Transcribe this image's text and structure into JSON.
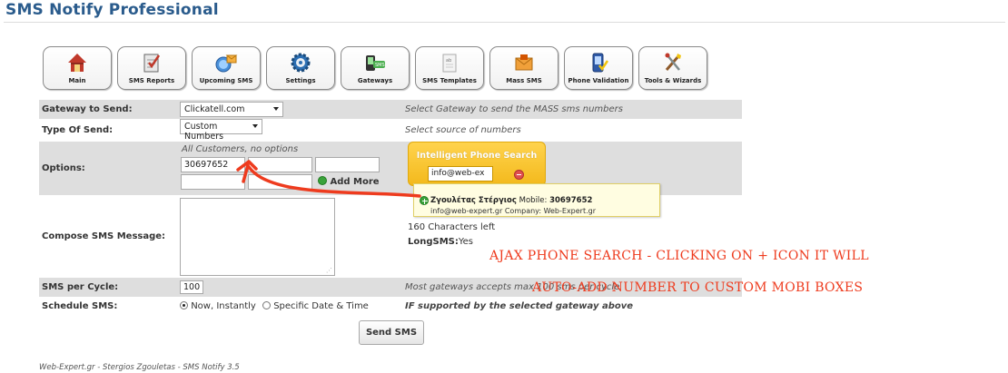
{
  "app": {
    "title": "SMS Notify Professional"
  },
  "toolbar": {
    "buttons": [
      {
        "label": "Main",
        "icon": "house-icon"
      },
      {
        "label": "SMS Reports",
        "icon": "report-icon"
      },
      {
        "label": "Upcoming SMS",
        "icon": "upcoming-icon"
      },
      {
        "label": "Settings",
        "icon": "gear-icon"
      },
      {
        "label": "Gateways",
        "icon": "gateway-icon"
      },
      {
        "label": "SMS Templates",
        "icon": "template-icon"
      },
      {
        "label": "Mass SMS",
        "icon": "envelope-icon"
      },
      {
        "label": "Phone Validation",
        "icon": "phone-icon"
      },
      {
        "label": "Tools & Wizards",
        "icon": "tools-icon"
      }
    ]
  },
  "form": {
    "gateway": {
      "label": "Gateway to Send:",
      "value": "Clickatell.com",
      "hint": "Select Gateway to send the MASS sms numbers"
    },
    "type_of_send": {
      "label": "Type Of Send:",
      "value": "Custom Numbers",
      "hint": "Select source of numbers"
    },
    "options": {
      "label": "Options:",
      "note": "All Customers, no options",
      "number_1": "30697652",
      "add_more": "Add More"
    },
    "compose": {
      "label": "Compose SMS Message:",
      "chars_left": "160 Characters left",
      "longsms_label": "LongSMS:",
      "longsms_value": "Yes"
    },
    "sms_per_cycle": {
      "label": "SMS per Cycle:",
      "value": "100",
      "hint": "Most gateways accepts max 100 sms per cycle"
    },
    "schedule": {
      "label": "Schedule SMS:",
      "option_now": "Now, Instantly",
      "option_specific": "Specific Date & Time",
      "hint": "IF supported by the selected gateway above"
    }
  },
  "phone_search": {
    "title": "Intelligent Phone Search",
    "query": "info@web-ex",
    "result": {
      "name": "Ζγουλέτας Στέργιος",
      "mobile_label": "Mobile:",
      "mobile": "30697652",
      "email": "info@web-expert.gr",
      "company_label": "Company:",
      "company": "Web-Expert.gr"
    }
  },
  "send_button": "Send SMS",
  "footer": "Web-Expert.gr - Stergios Zgouletas - SMS Notify 3.5",
  "annotation": {
    "line1": "AJAX PHONE SEARCH - CLICKING ON + ICON IT WILL",
    "line2": "AUTO-ADD NUMBER TO CUSTOM MOBI BOXES"
  },
  "colors": {
    "title": "#2a5b8c",
    "row_grey": "#dedede",
    "annotation": "#ee3b1e",
    "search_box": "#f3b91c"
  }
}
